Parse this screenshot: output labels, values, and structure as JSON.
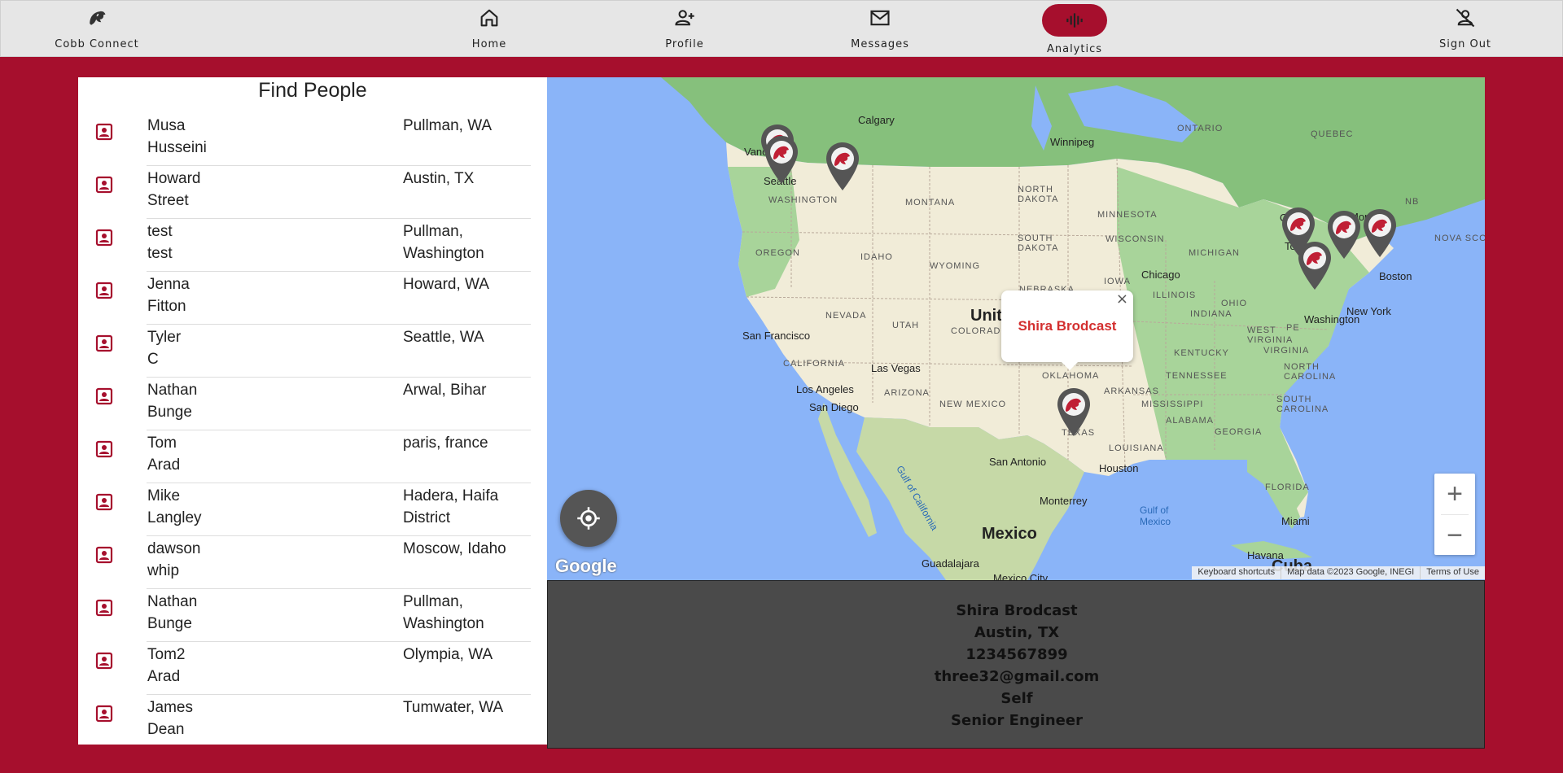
{
  "nav": {
    "brand_label": "Cobb Connect",
    "home_label": "Home",
    "profile_label": "Profile",
    "messages_label": "Messages",
    "analytics_label": "Analytics",
    "signout_label": "Sign Out",
    "accent_color": "#a60f2d"
  },
  "people": {
    "title": "Find People",
    "rows": [
      {
        "name": "Musa\nHusseini",
        "location": "Pullman, WA"
      },
      {
        "name": "Howard\nStreet",
        "location": "Austin, TX"
      },
      {
        "name": "test\ntest",
        "location": "Pullman,\nWashington"
      },
      {
        "name": "Jenna\nFitton",
        "location": "Howard, WA"
      },
      {
        "name": "Tyler\nC",
        "location": "Seattle, WA"
      },
      {
        "name": "Nathan\nBunge",
        "location": "Arwal, Bihar"
      },
      {
        "name": "Tom\nArad",
        "location": "paris, france"
      },
      {
        "name": "Mike\nLangley",
        "location": "Hadera, Haifa\nDistrict"
      },
      {
        "name": "dawson\nwhip",
        "location": "Moscow, Idaho"
      },
      {
        "name": "Nathan\nBunge",
        "location": "Pullman,\nWashington"
      },
      {
        "name": "Tom2\nArad",
        "location": "Olympia, WA"
      },
      {
        "name": "James\nDean",
        "location": "Tumwater, WA"
      }
    ]
  },
  "map": {
    "labels": {
      "ontario": "ONTARIO",
      "quebec": "QUEBEC",
      "nb": "NB",
      "nova_scotia": "NOVA SCOT",
      "calgary": "Calgary",
      "winnipeg": "Winnipeg",
      "vancouver": "Vancouver",
      "seattle": "Seattle",
      "washington_state": "WASHINGTON",
      "montana": "MONTANA",
      "north_dakota": "NORTH\nDAKOTA",
      "minnesota": "MINNESOTA",
      "ottawa": "Ottawa",
      "montreal": "Montreal",
      "oregon": "OREGON",
      "idaho": "IDAHO",
      "wyoming": "WYOMING",
      "south_dakota": "SOUTH\nDAKOTA",
      "wisconsin": "WISCONSIN",
      "michigan": "MICHIGAN",
      "toronto": "Toronto",
      "chicago": "Chicago",
      "boston": "Boston",
      "iowa": "IOWA",
      "nebraska": "NEBRASKA",
      "illinois": "ILLINOIS",
      "ohio": "OHIO",
      "indiana": "INDIANA",
      "new_york": "New York",
      "washington_dc": "Washington",
      "nevada": "NEVADA",
      "utah": "UTAH",
      "colorado": "COLORADO",
      "united": "Unit",
      "san_francisco": "San Francisco",
      "west_virginia": "WEST\nVIRGINIA",
      "virginia": "VIRGINIA",
      "kentucky": "KENTUCKY",
      "california": "CALIFORNIA",
      "las_vegas": "Las Vegas",
      "oklahoma": "OKLAHOMA",
      "tennessee": "TENNESSEE",
      "north_carolina": "NORTH\nCAROLINA",
      "los_angeles": "Los Angeles",
      "arizona": "ARIZONA",
      "arkansas": "ARKANSAS",
      "san_diego": "San Diego",
      "new_mexico": "NEW MEXICO",
      "mississippi": "MISSISSIPPI",
      "south_carolina": "SOUTH\nCAROLINA",
      "alabama": "ALABAMA",
      "georgia": "GEORGIA",
      "texas": "TEXAS",
      "dallas": "as",
      "louisiana": "LOUISIANA",
      "san_antonio": "San Antonio",
      "houston": "Houston",
      "florida": "FLORIDA",
      "gulf_california": "Gulf of California",
      "monterrey": "Monterrey",
      "gulf_mexico": "Gulf of\nMexico",
      "miami": "Miami",
      "mexico": "Mexico",
      "havana": "Havana",
      "guadalajara": "Guadalajara",
      "cuba": "Cuba",
      "mexico_city": "Mexico City",
      "pe": "PE"
    },
    "popup_name": "Shira Brodcast",
    "popup_close": "×",
    "zoom_in": "+",
    "zoom_out": "−",
    "google_logo": "Google",
    "attribution": {
      "shortcuts": "Keyboard shortcuts",
      "map_data": "Map data ©2023 Google, INEGI",
      "terms": "Terms of Use"
    },
    "pin_color": "#555555"
  },
  "details": {
    "name": "Shira Brodcast",
    "location": "Austin, TX",
    "phone": "1234567899",
    "email": "three32@gmail.com",
    "company": "Self",
    "title": "Senior Engineer"
  }
}
